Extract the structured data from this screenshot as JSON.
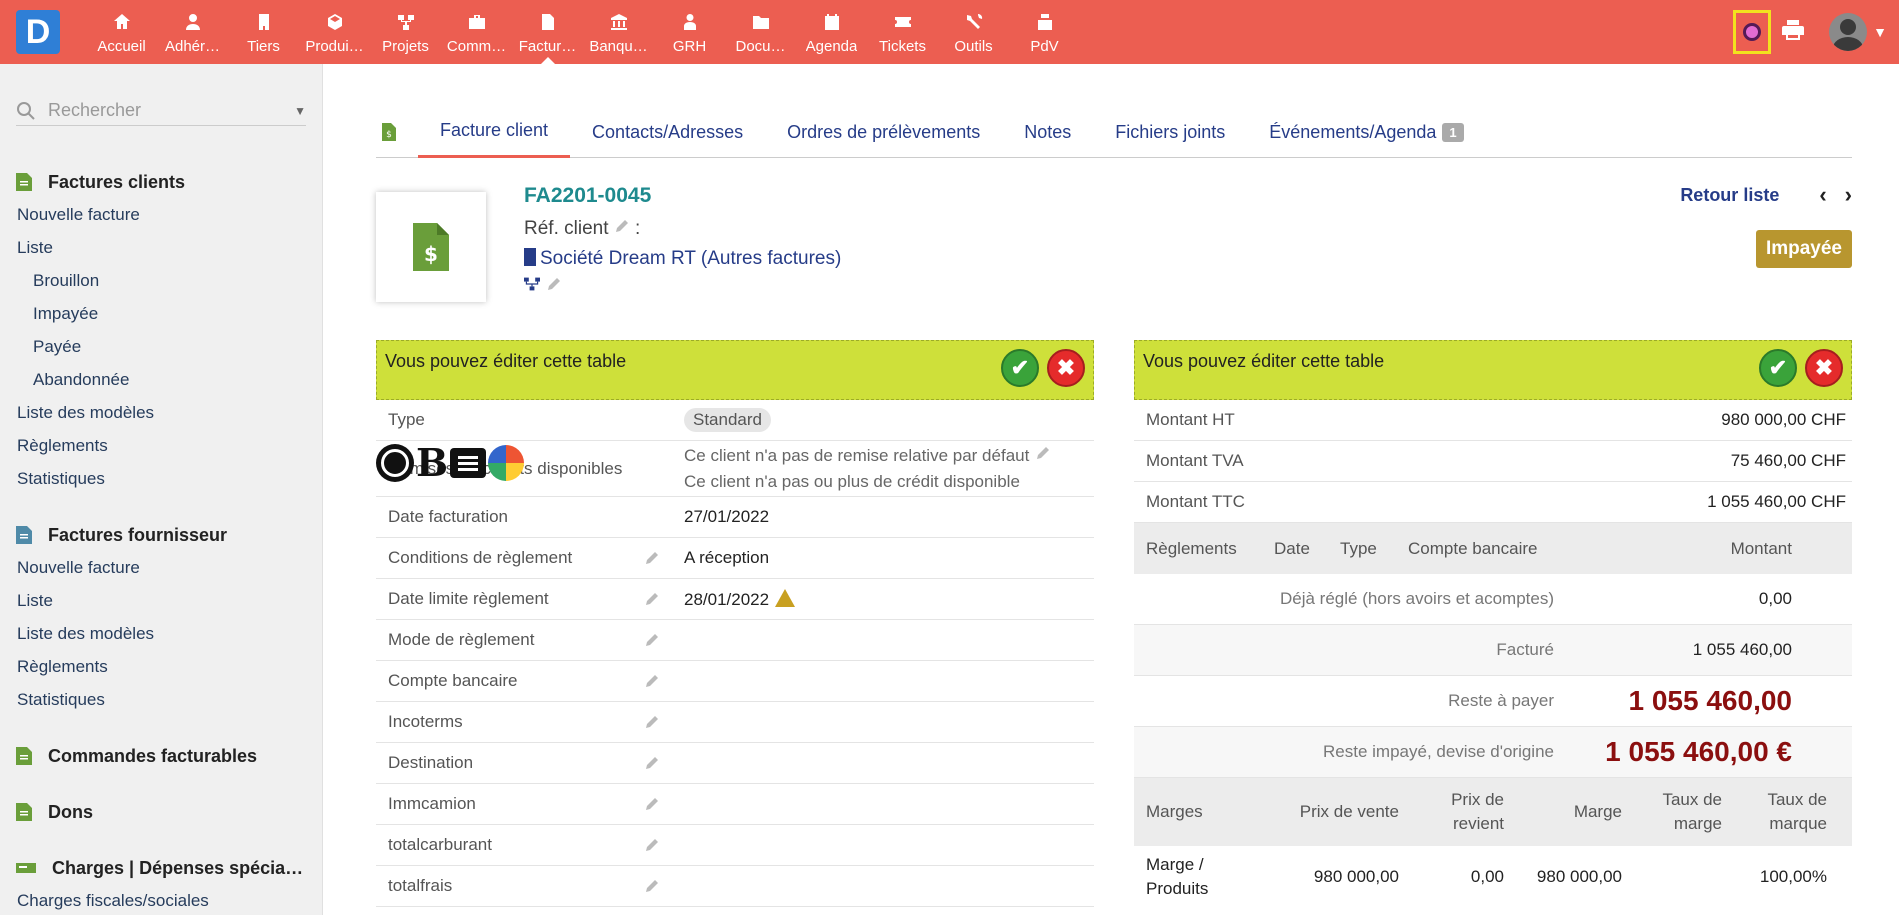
{
  "app": {
    "logo_letter": "D"
  },
  "nav": [
    {
      "label": "Accueil",
      "icon": "home-icon"
    },
    {
      "label": "Adhér…",
      "icon": "member-icon"
    },
    {
      "label": "Tiers",
      "icon": "building-icon"
    },
    {
      "label": "Produi…",
      "icon": "cube-icon"
    },
    {
      "label": "Projets",
      "icon": "project-icon"
    },
    {
      "label": "Comm…",
      "icon": "briefcase-icon"
    },
    {
      "label": "Factur…",
      "icon": "invoice-icon"
    },
    {
      "label": "Banqu…",
      "icon": "bank-icon"
    },
    {
      "label": "GRH",
      "icon": "hr-icon"
    },
    {
      "label": "Docu…",
      "icon": "folder-icon"
    },
    {
      "label": "Agenda",
      "icon": "calendar-icon"
    },
    {
      "label": "Tickets",
      "icon": "ticket-icon"
    },
    {
      "label": "Outils",
      "icon": "tools-icon"
    },
    {
      "label": "PdV",
      "icon": "cash-register-icon"
    }
  ],
  "sidebar": {
    "search_placeholder": "Rechercher",
    "sections": [
      {
        "title": "Factures clients",
        "items": [
          {
            "label": "Nouvelle facture",
            "sub": false
          },
          {
            "label": "Liste",
            "sub": false
          },
          {
            "label": "Brouillon",
            "sub": true
          },
          {
            "label": "Impayée",
            "sub": true
          },
          {
            "label": "Payée",
            "sub": true
          },
          {
            "label": "Abandonnée",
            "sub": true
          },
          {
            "label": "Liste des modèles",
            "sub": false
          },
          {
            "label": "Règlements",
            "sub": false
          },
          {
            "label": "Statistiques",
            "sub": false
          }
        ]
      },
      {
        "title": "Factures fournisseur",
        "items": [
          {
            "label": "Nouvelle facture",
            "sub": false
          },
          {
            "label": "Liste",
            "sub": false
          },
          {
            "label": "Liste des modèles",
            "sub": false
          },
          {
            "label": "Règlements",
            "sub": false
          },
          {
            "label": "Statistiques",
            "sub": false
          }
        ]
      },
      {
        "title": "Commandes facturables",
        "items": []
      },
      {
        "title": "Dons",
        "items": []
      },
      {
        "title": "Charges | Dépenses spécia…",
        "items": [
          {
            "label": "Charges fiscales/sociales",
            "sub": false
          }
        ]
      }
    ]
  },
  "tabs": [
    {
      "label": "Facture client",
      "active": true
    },
    {
      "label": "Contacts/Adresses",
      "active": false
    },
    {
      "label": "Ordres de prélèvements",
      "active": false
    },
    {
      "label": "Notes",
      "active": false
    },
    {
      "label": "Fichiers joints",
      "active": false
    },
    {
      "label": "Événements/Agenda",
      "active": false,
      "count": "1"
    }
  ],
  "header": {
    "ref": "FA2201-0045",
    "ref_client_label": "Réf. client",
    "ref_client_sep": " :",
    "company": "Société Dream RT",
    "company_suffix_open": " (",
    "company_group": "Autres factures",
    "company_suffix_close": ")",
    "back_label": "Retour liste",
    "prev": "‹",
    "next": "›",
    "status": "Impayée"
  },
  "edit_text": "Vous pouvez éditer cette table",
  "left_table": [
    {
      "key": "Type",
      "value": "Standard",
      "pill": true,
      "editable": false
    },
    {
      "key": "Remises ou crédits disponibles",
      "lines": [
        "Ce client n'a pas de remise relative par défaut",
        "Ce client n'a pas ou plus de crédit disponible"
      ],
      "editable": false
    },
    {
      "key": "Date facturation",
      "value": "27/01/2022",
      "editable": false
    },
    {
      "key": "Conditions de règlement",
      "value": "A réception",
      "editable": true
    },
    {
      "key": "Date limite règlement",
      "value": "28/01/2022",
      "warn": true,
      "editable": true
    },
    {
      "key": "Mode de règlement",
      "value": "",
      "editable": true
    },
    {
      "key": "Compte bancaire",
      "value": "",
      "editable": true
    },
    {
      "key": "Incoterms",
      "value": "",
      "editable": true
    },
    {
      "key": "Destination",
      "value": "",
      "editable": true
    },
    {
      "key": "Immcamion",
      "value": "",
      "editable": true
    },
    {
      "key": "totalcarburant",
      "value": "",
      "editable": true
    },
    {
      "key": "totalfrais",
      "value": "",
      "editable": true
    }
  ],
  "amounts": [
    {
      "key": "Montant HT",
      "value": "980 000,00 CHF"
    },
    {
      "key": "Montant TVA",
      "value": "75 460,00 CHF"
    },
    {
      "key": "Montant TTC",
      "value": "1 055 460,00 CHF"
    }
  ],
  "payments_head": [
    "Règlements",
    "Date",
    "Type",
    "Compte bancaire",
    "Montant"
  ],
  "payments_summary": [
    {
      "key": "Déjà réglé (hors avoirs et acomptes)",
      "value": "0,00",
      "big": false
    },
    {
      "key": "Facturé",
      "value": "1 055 460,00",
      "big": false
    },
    {
      "key": "Reste à payer",
      "value": "1 055 460,00",
      "big": true
    },
    {
      "key": "Reste impayé, devise d'origine",
      "value": "1 055 460,00 €",
      "big": true
    }
  ],
  "margins_head": [
    "Marges",
    "Prix de vente",
    "Prix de revient",
    "Marge",
    "Taux de marge",
    "Taux de marque"
  ],
  "margins_rows": [
    [
      "Marge / Produits",
      "980 000,00",
      "0,00",
      "980 000,00",
      "",
      "100,00%"
    ]
  ]
}
